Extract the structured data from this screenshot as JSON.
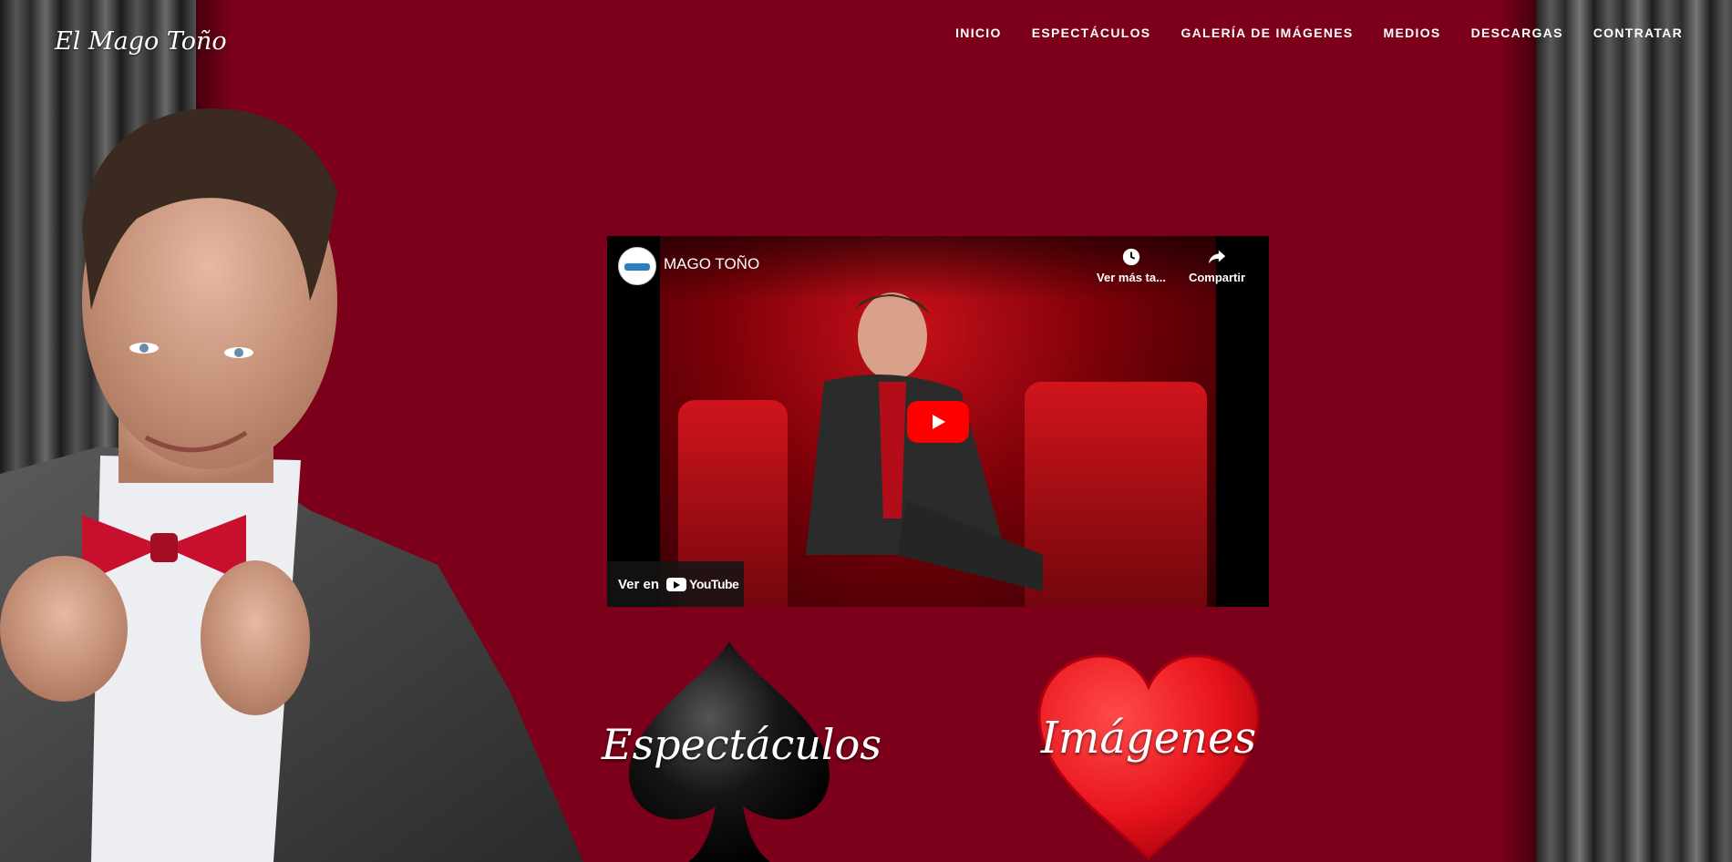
{
  "brand": {
    "name": "El Mago Toño"
  },
  "nav": {
    "items": [
      "INICIO",
      "ESPECTÁCULOS",
      "GALERÍA DE IMÁGENES",
      "MEDIOS",
      "DESCARGAS",
      "CONTRATAR"
    ]
  },
  "video": {
    "title": "MAGO TOÑO",
    "watch_later": "Ver más ta...",
    "share": "Compartir",
    "watch_on": "Ver en",
    "platform": "YouTube"
  },
  "cards": {
    "spade_label": "Espectáculos",
    "heart_label": "Imágenes"
  },
  "colors": {
    "background": "#7c0019",
    "youtube_red": "#ff0000",
    "heart_red": "#e8141c"
  },
  "icons": {
    "watch_later": "clock-icon",
    "share": "share-icon",
    "play": "play-icon"
  }
}
